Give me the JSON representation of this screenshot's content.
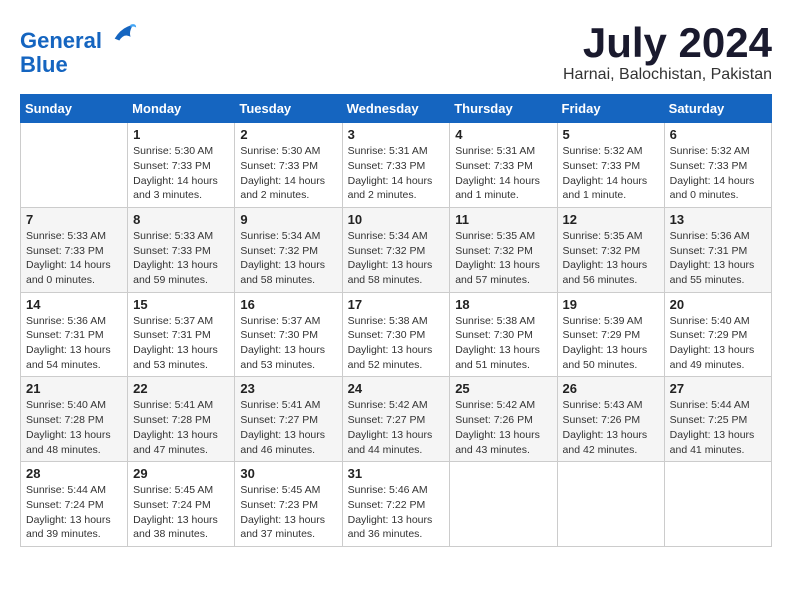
{
  "header": {
    "logo_line1": "General",
    "logo_line2": "Blue",
    "month_title": "July 2024",
    "location": "Harnai, Balochistan, Pakistan"
  },
  "days_of_week": [
    "Sunday",
    "Monday",
    "Tuesday",
    "Wednesday",
    "Thursday",
    "Friday",
    "Saturday"
  ],
  "weeks": [
    [
      {
        "day": "",
        "info": ""
      },
      {
        "day": "1",
        "info": "Sunrise: 5:30 AM\nSunset: 7:33 PM\nDaylight: 14 hours\nand 3 minutes."
      },
      {
        "day": "2",
        "info": "Sunrise: 5:30 AM\nSunset: 7:33 PM\nDaylight: 14 hours\nand 2 minutes."
      },
      {
        "day": "3",
        "info": "Sunrise: 5:31 AM\nSunset: 7:33 PM\nDaylight: 14 hours\nand 2 minutes."
      },
      {
        "day": "4",
        "info": "Sunrise: 5:31 AM\nSunset: 7:33 PM\nDaylight: 14 hours\nand 1 minute."
      },
      {
        "day": "5",
        "info": "Sunrise: 5:32 AM\nSunset: 7:33 PM\nDaylight: 14 hours\nand 1 minute."
      },
      {
        "day": "6",
        "info": "Sunrise: 5:32 AM\nSunset: 7:33 PM\nDaylight: 14 hours\nand 0 minutes."
      }
    ],
    [
      {
        "day": "7",
        "info": "Sunrise: 5:33 AM\nSunset: 7:33 PM\nDaylight: 14 hours\nand 0 minutes."
      },
      {
        "day": "8",
        "info": "Sunrise: 5:33 AM\nSunset: 7:33 PM\nDaylight: 13 hours\nand 59 minutes."
      },
      {
        "day": "9",
        "info": "Sunrise: 5:34 AM\nSunset: 7:32 PM\nDaylight: 13 hours\nand 58 minutes."
      },
      {
        "day": "10",
        "info": "Sunrise: 5:34 AM\nSunset: 7:32 PM\nDaylight: 13 hours\nand 58 minutes."
      },
      {
        "day": "11",
        "info": "Sunrise: 5:35 AM\nSunset: 7:32 PM\nDaylight: 13 hours\nand 57 minutes."
      },
      {
        "day": "12",
        "info": "Sunrise: 5:35 AM\nSunset: 7:32 PM\nDaylight: 13 hours\nand 56 minutes."
      },
      {
        "day": "13",
        "info": "Sunrise: 5:36 AM\nSunset: 7:31 PM\nDaylight: 13 hours\nand 55 minutes."
      }
    ],
    [
      {
        "day": "14",
        "info": "Sunrise: 5:36 AM\nSunset: 7:31 PM\nDaylight: 13 hours\nand 54 minutes."
      },
      {
        "day": "15",
        "info": "Sunrise: 5:37 AM\nSunset: 7:31 PM\nDaylight: 13 hours\nand 53 minutes."
      },
      {
        "day": "16",
        "info": "Sunrise: 5:37 AM\nSunset: 7:30 PM\nDaylight: 13 hours\nand 53 minutes."
      },
      {
        "day": "17",
        "info": "Sunrise: 5:38 AM\nSunset: 7:30 PM\nDaylight: 13 hours\nand 52 minutes."
      },
      {
        "day": "18",
        "info": "Sunrise: 5:38 AM\nSunset: 7:30 PM\nDaylight: 13 hours\nand 51 minutes."
      },
      {
        "day": "19",
        "info": "Sunrise: 5:39 AM\nSunset: 7:29 PM\nDaylight: 13 hours\nand 50 minutes."
      },
      {
        "day": "20",
        "info": "Sunrise: 5:40 AM\nSunset: 7:29 PM\nDaylight: 13 hours\nand 49 minutes."
      }
    ],
    [
      {
        "day": "21",
        "info": "Sunrise: 5:40 AM\nSunset: 7:28 PM\nDaylight: 13 hours\nand 48 minutes."
      },
      {
        "day": "22",
        "info": "Sunrise: 5:41 AM\nSunset: 7:28 PM\nDaylight: 13 hours\nand 47 minutes."
      },
      {
        "day": "23",
        "info": "Sunrise: 5:41 AM\nSunset: 7:27 PM\nDaylight: 13 hours\nand 46 minutes."
      },
      {
        "day": "24",
        "info": "Sunrise: 5:42 AM\nSunset: 7:27 PM\nDaylight: 13 hours\nand 44 minutes."
      },
      {
        "day": "25",
        "info": "Sunrise: 5:42 AM\nSunset: 7:26 PM\nDaylight: 13 hours\nand 43 minutes."
      },
      {
        "day": "26",
        "info": "Sunrise: 5:43 AM\nSunset: 7:26 PM\nDaylight: 13 hours\nand 42 minutes."
      },
      {
        "day": "27",
        "info": "Sunrise: 5:44 AM\nSunset: 7:25 PM\nDaylight: 13 hours\nand 41 minutes."
      }
    ],
    [
      {
        "day": "28",
        "info": "Sunrise: 5:44 AM\nSunset: 7:24 PM\nDaylight: 13 hours\nand 39 minutes."
      },
      {
        "day": "29",
        "info": "Sunrise: 5:45 AM\nSunset: 7:24 PM\nDaylight: 13 hours\nand 38 minutes."
      },
      {
        "day": "30",
        "info": "Sunrise: 5:45 AM\nSunset: 7:23 PM\nDaylight: 13 hours\nand 37 minutes."
      },
      {
        "day": "31",
        "info": "Sunrise: 5:46 AM\nSunset: 7:22 PM\nDaylight: 13 hours\nand 36 minutes."
      },
      {
        "day": "",
        "info": ""
      },
      {
        "day": "",
        "info": ""
      },
      {
        "day": "",
        "info": ""
      }
    ]
  ]
}
